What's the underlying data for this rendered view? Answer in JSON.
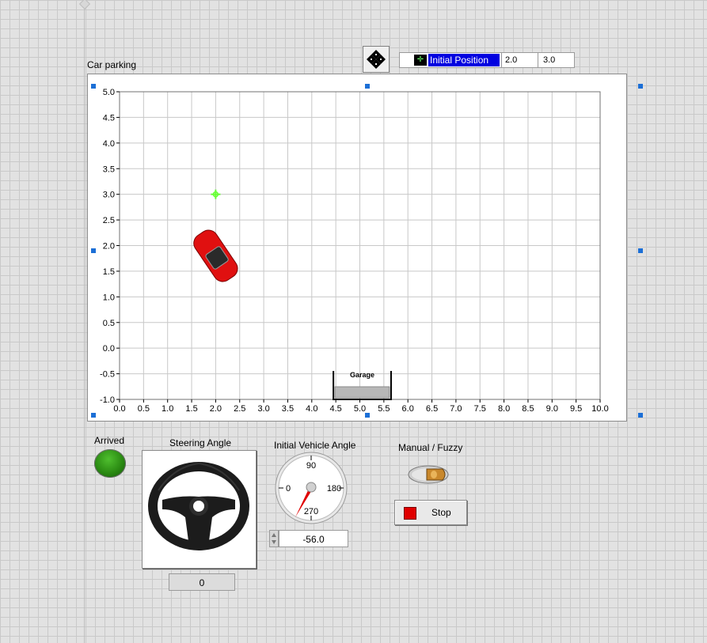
{
  "graph": {
    "title": "Car parking",
    "cursor": {
      "name": "Initial Position",
      "x_value": "2.0",
      "y_value": "3.0",
      "color": "#66ff33"
    },
    "garage_label": "Garage"
  },
  "chart_data": {
    "type": "scatter",
    "title": "Car parking",
    "xlabel": "",
    "ylabel": "",
    "xlim": [
      0.0,
      10.0
    ],
    "ylim": [
      -1.0,
      5.0
    ],
    "x_ticks": [
      "0.0",
      "0.5",
      "1.0",
      "1.5",
      "2.0",
      "2.5",
      "3.0",
      "3.5",
      "4.0",
      "4.5",
      "5.0",
      "5.5",
      "6.0",
      "6.5",
      "7.0",
      "7.5",
      "8.0",
      "8.5",
      "9.0",
      "9.5",
      "10.0"
    ],
    "y_ticks": [
      "5.0",
      "4.5",
      "4.0",
      "3.5",
      "3.0",
      "2.5",
      "2.0",
      "1.5",
      "1.0",
      "0.5",
      "0.0",
      "-0.5",
      "-1.0"
    ],
    "grid": true,
    "points": [
      {
        "x": 2.0,
        "y": 3.0
      }
    ],
    "car": {
      "x": 2.0,
      "y": 1.8,
      "heading_deg": -56,
      "color": "#e01010"
    },
    "garage": {
      "x_from": 4.45,
      "x_to": 5.65,
      "y": -1.0
    }
  },
  "controls": {
    "arrived_label": "Arrived",
    "arrived_led_color": "#2a8a12",
    "steering_label": "Steering Angle",
    "steering_value": "0",
    "initial_angle_label": "Initial Vehicle Angle",
    "initial_angle_value": "-56.0",
    "dial_marks": [
      "90",
      "0",
      "180",
      "270"
    ],
    "mode_label": "Manual / Fuzzy",
    "stop_label": "Stop"
  }
}
